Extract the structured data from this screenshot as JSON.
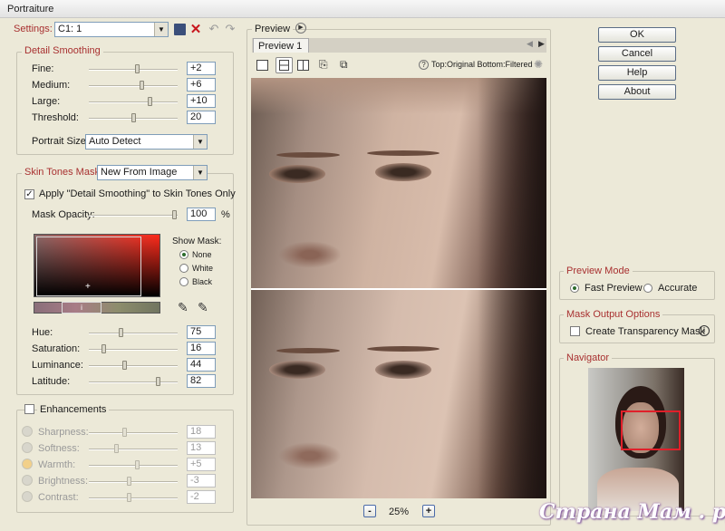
{
  "window": {
    "title": "Portraiture"
  },
  "settings": {
    "label": "Settings:",
    "value": "C1: 1"
  },
  "detail": {
    "legend": "Detail Smoothing",
    "rows": [
      {
        "label": "Fine:",
        "value": "+2",
        "level": 0.55
      },
      {
        "label": "Medium:",
        "value": "+6",
        "level": 0.6
      },
      {
        "label": "Large:",
        "value": "+10",
        "level": 0.7
      },
      {
        "label": "Threshold:",
        "value": "20",
        "level": 0.5
      }
    ],
    "portrait_label": "Portrait Size:",
    "portrait_value": "Auto Detect"
  },
  "skin": {
    "legend": "Skin Tones Mask:",
    "mask_source": "New From Image",
    "apply_label": "Apply \"Detail Smoothing\" to Skin Tones Only",
    "opacity_label": "Mask Opacity:",
    "opacity_value": "100",
    "opacity_unit": "%",
    "show_mask_label": "Show Mask:",
    "show_mask_options": [
      "None",
      "White",
      "Black"
    ],
    "rows": [
      {
        "label": "Hue:",
        "value": "75",
        "level": 0.35
      },
      {
        "label": "Saturation:",
        "value": "16",
        "level": 0.15
      },
      {
        "label": "Luminance:",
        "value": "44",
        "level": 0.4
      },
      {
        "label": "Latitude:",
        "value": "82",
        "level": 0.8
      }
    ]
  },
  "enh": {
    "legend": "Enhancements",
    "rows": [
      {
        "label": "Sharpness:",
        "value": "18",
        "level": 0.4,
        "icon": "sharpness-icon"
      },
      {
        "label": "Softness:",
        "value": "13",
        "level": 0.3,
        "icon": "softness-icon"
      },
      {
        "label": "Warmth:",
        "value": "+5",
        "level": 0.55,
        "icon": "warmth-icon"
      },
      {
        "label": "Brightness:",
        "value": "-3",
        "level": 0.45,
        "icon": "brightness-icon"
      },
      {
        "label": "Contrast:",
        "value": "-2",
        "level": 0.45,
        "icon": "contrast-icon"
      }
    ]
  },
  "preview": {
    "legend": "Preview",
    "tab": "Preview 1",
    "mode_text": "Top:Original Bottom:Filtered",
    "zoom": "25%",
    "zoom_out": "-",
    "zoom_in": "+"
  },
  "buttons": {
    "ok": "OK",
    "cancel": "Cancel",
    "help": "Help",
    "about": "About"
  },
  "preview_mode": {
    "legend": "Preview Mode",
    "fast": "Fast Preview",
    "accurate": "Accurate"
  },
  "mask_output": {
    "legend": "Mask Output Options",
    "create": "Create Transparency Mask"
  },
  "navigator": {
    "legend": "Navigator"
  },
  "watermark": "Страна Мам . ру",
  "colors": {
    "legend_red": "#a83030",
    "accent": "#2c6b2c",
    "nav_rect": "#e0202a"
  }
}
